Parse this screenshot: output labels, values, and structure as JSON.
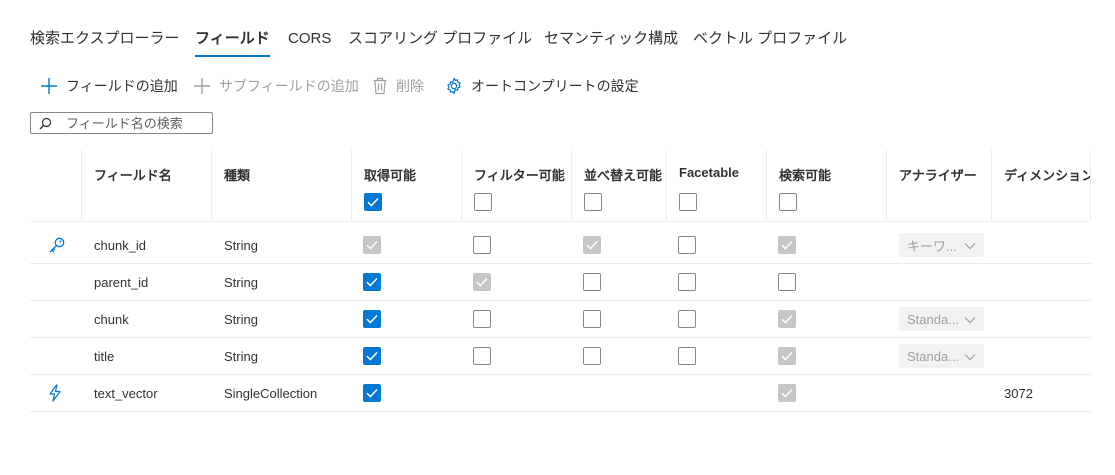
{
  "tabs": [
    {
      "label": "検索エクスプローラー",
      "active": false
    },
    {
      "label": "フィールド",
      "active": true
    },
    {
      "label": "CORS",
      "active": false
    },
    {
      "label": "スコアリング プロファイル",
      "active": false
    },
    {
      "label": "セマンティック構成",
      "active": false
    },
    {
      "label": "ベクトル プロファイル",
      "active": false
    }
  ],
  "toolbar": {
    "add_field": "フィールドの追加",
    "add_subfield": "サブフィールドの追加",
    "delete": "削除",
    "autocomplete": "オートコンプリートの設定"
  },
  "search": {
    "placeholder": "フィールド名の検索"
  },
  "columns": {
    "name": "フィールド名",
    "type": "種類",
    "retrievable": "取得可能",
    "filterable": "フィルター可能",
    "sortable": "並べ替え可能",
    "facetable": "Facetable",
    "searchable": "検索可能",
    "analyzer": "アナライザー",
    "dimension": "ディメンション"
  },
  "header_checks": {
    "retrievable": "checked",
    "filterable": "unchecked",
    "sortable": "unchecked",
    "facetable": "unchecked",
    "searchable": "unchecked"
  },
  "rows": [
    {
      "icon": "key-icon",
      "name": "chunk_id",
      "type": "String",
      "retrievable": "disabled-checked",
      "filterable": "unchecked",
      "sortable": "disabled-checked",
      "facetable": "unchecked",
      "searchable": "disabled-checked",
      "analyzer": "キーワ...",
      "dimension": ""
    },
    {
      "icon": "",
      "name": "parent_id",
      "type": "String",
      "retrievable": "checked",
      "filterable": "disabled-checked",
      "sortable": "unchecked",
      "facetable": "unchecked",
      "searchable": "unchecked",
      "analyzer": "",
      "dimension": ""
    },
    {
      "icon": "",
      "name": "chunk",
      "type": "String",
      "retrievable": "checked",
      "filterable": "unchecked",
      "sortable": "unchecked",
      "facetable": "unchecked",
      "searchable": "disabled-checked",
      "analyzer": "Standa...",
      "dimension": ""
    },
    {
      "icon": "",
      "name": "title",
      "type": "String",
      "retrievable": "checked",
      "filterable": "unchecked",
      "sortable": "unchecked",
      "facetable": "unchecked",
      "searchable": "disabled-checked",
      "analyzer": "Standa...",
      "dimension": ""
    },
    {
      "icon": "lightning-icon",
      "name": "text_vector",
      "type": "SingleCollection",
      "retrievable": "checked",
      "filterable": "none",
      "sortable": "none",
      "facetable": "none",
      "searchable": "disabled-checked",
      "analyzer": "",
      "dimension": "3072"
    }
  ],
  "colors": {
    "accent": "#0078d4",
    "disabled": "#c8c6c4",
    "border": "#edebe9"
  }
}
